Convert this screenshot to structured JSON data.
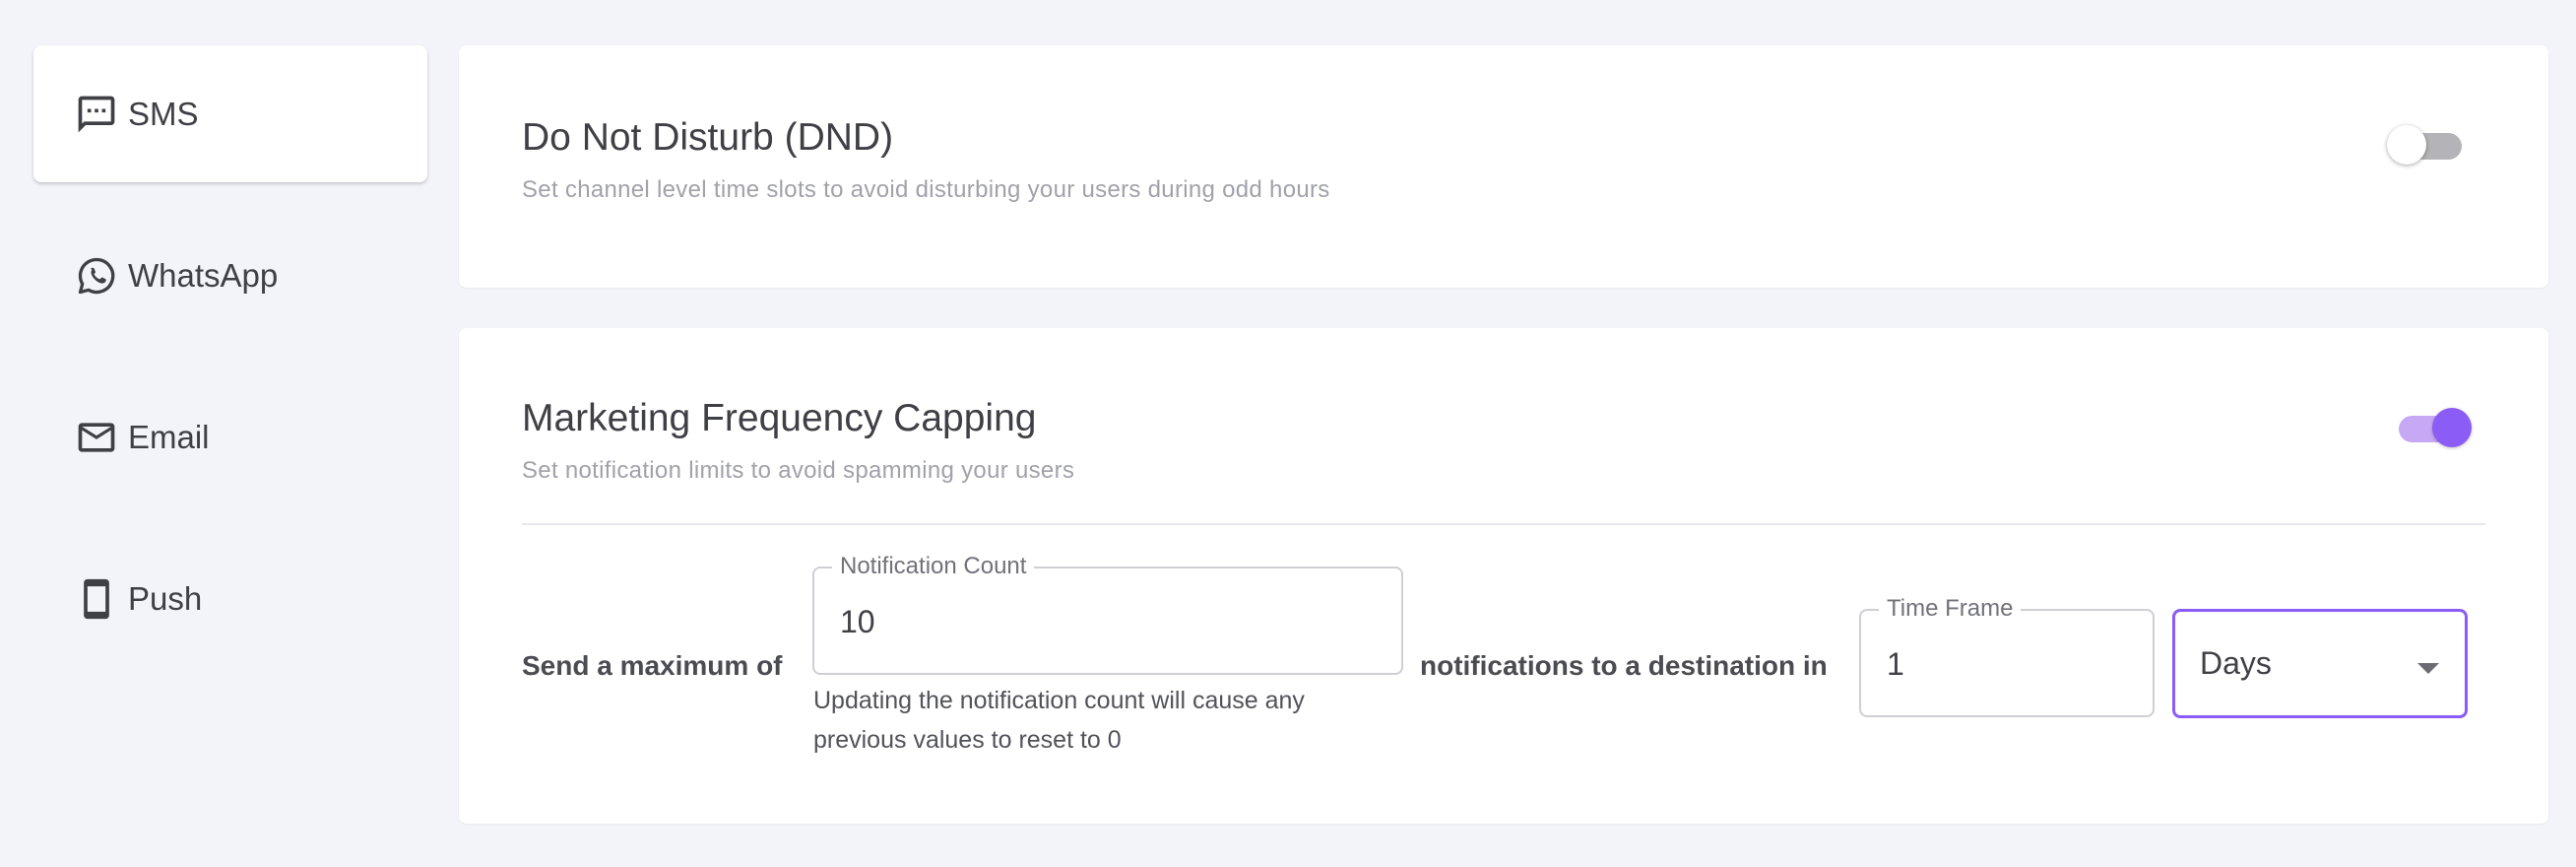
{
  "sidebar": {
    "items": [
      {
        "label": "SMS",
        "icon": "sms-icon",
        "active": true
      },
      {
        "label": "WhatsApp",
        "icon": "whatsapp-icon",
        "active": false
      },
      {
        "label": "Email",
        "icon": "email-icon",
        "active": false
      },
      {
        "label": "Push",
        "icon": "push-icon",
        "active": false
      }
    ]
  },
  "dnd": {
    "title": "Do Not Disturb (DND)",
    "description": "Set channel level time slots to avoid disturbing your users during odd hours",
    "enabled": false
  },
  "frequency_capping": {
    "title": "Marketing Frequency Capping",
    "description": "Set notification limits to avoid spamming your users",
    "enabled": true,
    "prefix_text": "Send a maximum of",
    "notification_count": {
      "label": "Notification Count",
      "value": "10",
      "helper": "Updating the notification count will cause any previous values to reset to 0"
    },
    "middle_text": "notifications to a destination in",
    "time_frame": {
      "label": "Time Frame",
      "value": "1"
    },
    "unit_select": {
      "value": "Days"
    }
  },
  "colors": {
    "accent": "#8b5cf6",
    "accent_light": "#c6a8f5",
    "background": "#f3f4f9",
    "muted_text": "#a1a1aa"
  }
}
